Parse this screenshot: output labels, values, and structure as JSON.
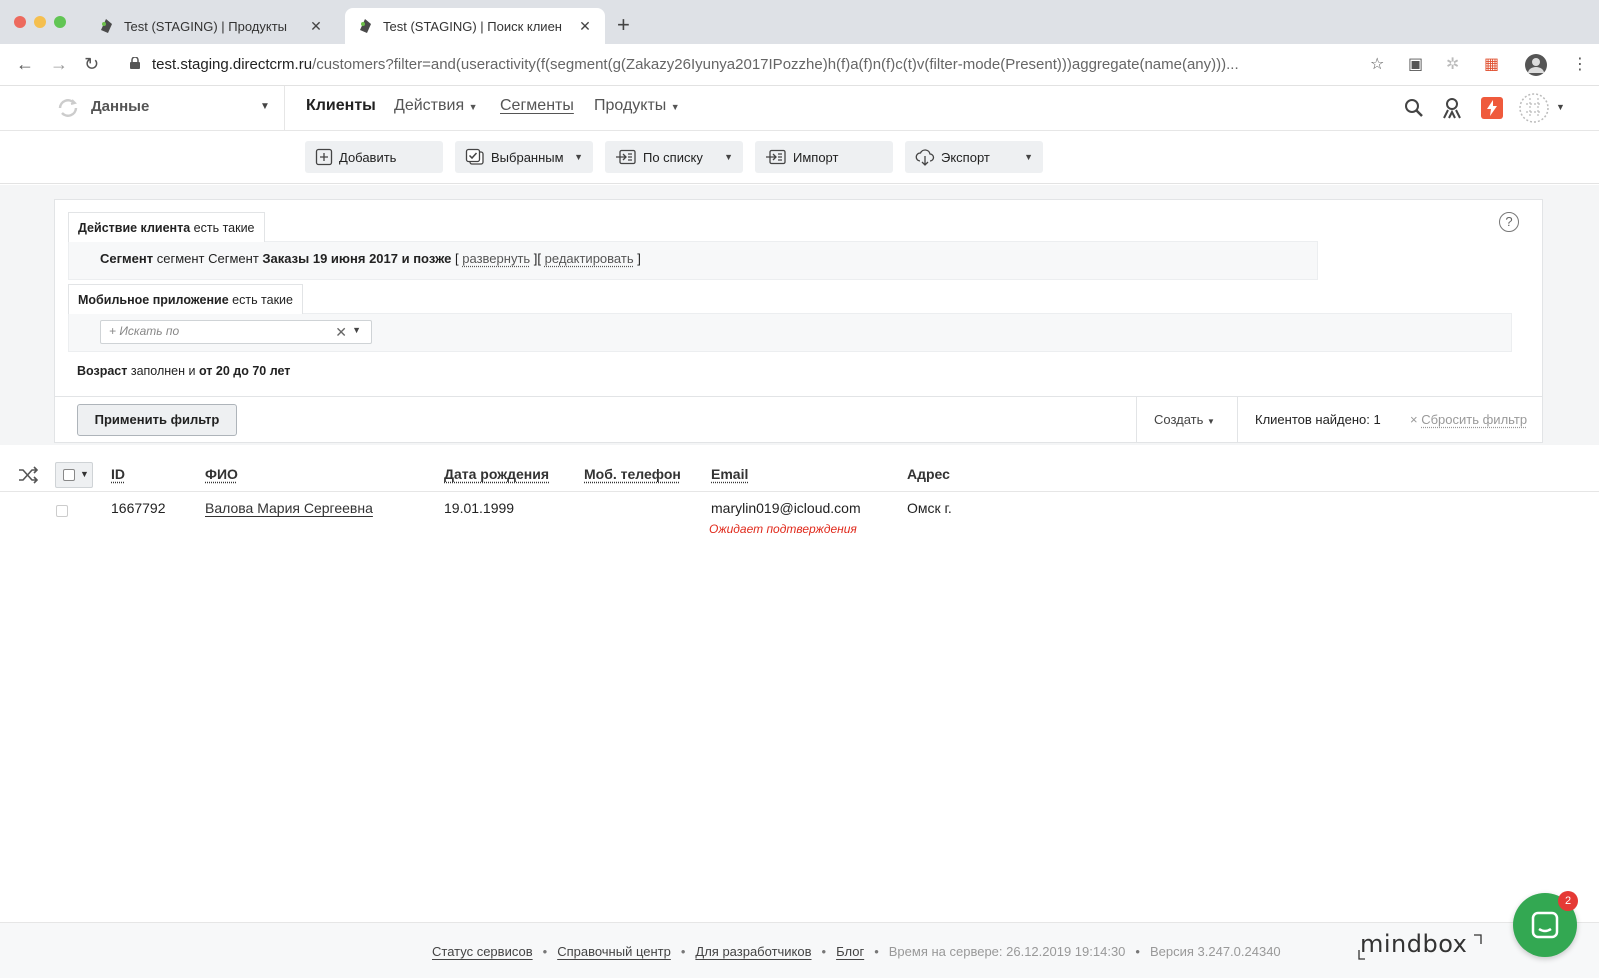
{
  "browser": {
    "tabs": [
      {
        "title": "Test (STAGING) | Продукты",
        "active": false
      },
      {
        "title": "Test (STAGING) | Поиск клиен",
        "active": true
      }
    ],
    "new_tab": "+",
    "url_host": "test.staging.directcrm.ru",
    "url_path": "/customers?filter=and(useractivity(f(segment(g(Zakazy26Iyunya2017IPozzhe)h(f)a(f)n(f)c(t)v(filter-mode(Present)))aggregate(name(any)))..."
  },
  "header": {
    "section": "Данные",
    "nav": {
      "clients": "Клиенты",
      "actions": "Действия",
      "segments": "Сегменты",
      "products": "Продукты"
    }
  },
  "toolbar": {
    "add": "Добавить",
    "selected": "Выбранным",
    "by_list": "По списку",
    "import": "Импорт",
    "export": "Экспорт"
  },
  "filter": {
    "action_tab": {
      "name": "Действие клиента",
      "mode": "есть такие"
    },
    "segment": {
      "label": "Сегмент",
      "prefix": "сегмент Сегмент",
      "name": "Заказы 19 июня 2017 и позже",
      "open_bracket": "[",
      "expand": "развернуть",
      "mid_bracket": "][",
      "edit": "редактировать",
      "close_bracket": "]"
    },
    "mobile_tab": {
      "name": "Мобильное приложение",
      "mode": "есть такие"
    },
    "search_placeholder": "+ Искать по",
    "age": {
      "label": "Возраст",
      "filled": "заполнен и",
      "range": "от 20 до 70 лет"
    },
    "apply": "Применить фильтр",
    "create": "Создать",
    "found": "Клиентов найдено: 1",
    "reset": "Сбросить фильтр",
    "help": "?"
  },
  "table": {
    "columns": {
      "id": "ID",
      "name": "ФИО",
      "birth": "Дата рождения",
      "phone": "Моб. телефон",
      "email": "Email",
      "address": "Адрес"
    },
    "rows": [
      {
        "id": "1667792",
        "name": "Валова Мария Сергеевна",
        "birth": "19.01.1999",
        "phone": "",
        "email": "marylin019@icloud.com",
        "email_status": "Ожидает подтверждения",
        "address": "Омск г."
      }
    ]
  },
  "footer": {
    "links": [
      "Статус сервисов",
      "Справочный центр",
      "Для разработчиков",
      "Блог"
    ],
    "server_time": "Время на сервере: 26.12.2019 19:14:30",
    "version": "Версия 3.247.0.24340",
    "brand": "mindbox"
  },
  "chat": {
    "badge": "2"
  },
  "colors": {
    "accent_green": "#33a852",
    "badge_red": "#e53935",
    "pending_red": "#e0291b",
    "notify_orange": "#ef5a3c"
  }
}
